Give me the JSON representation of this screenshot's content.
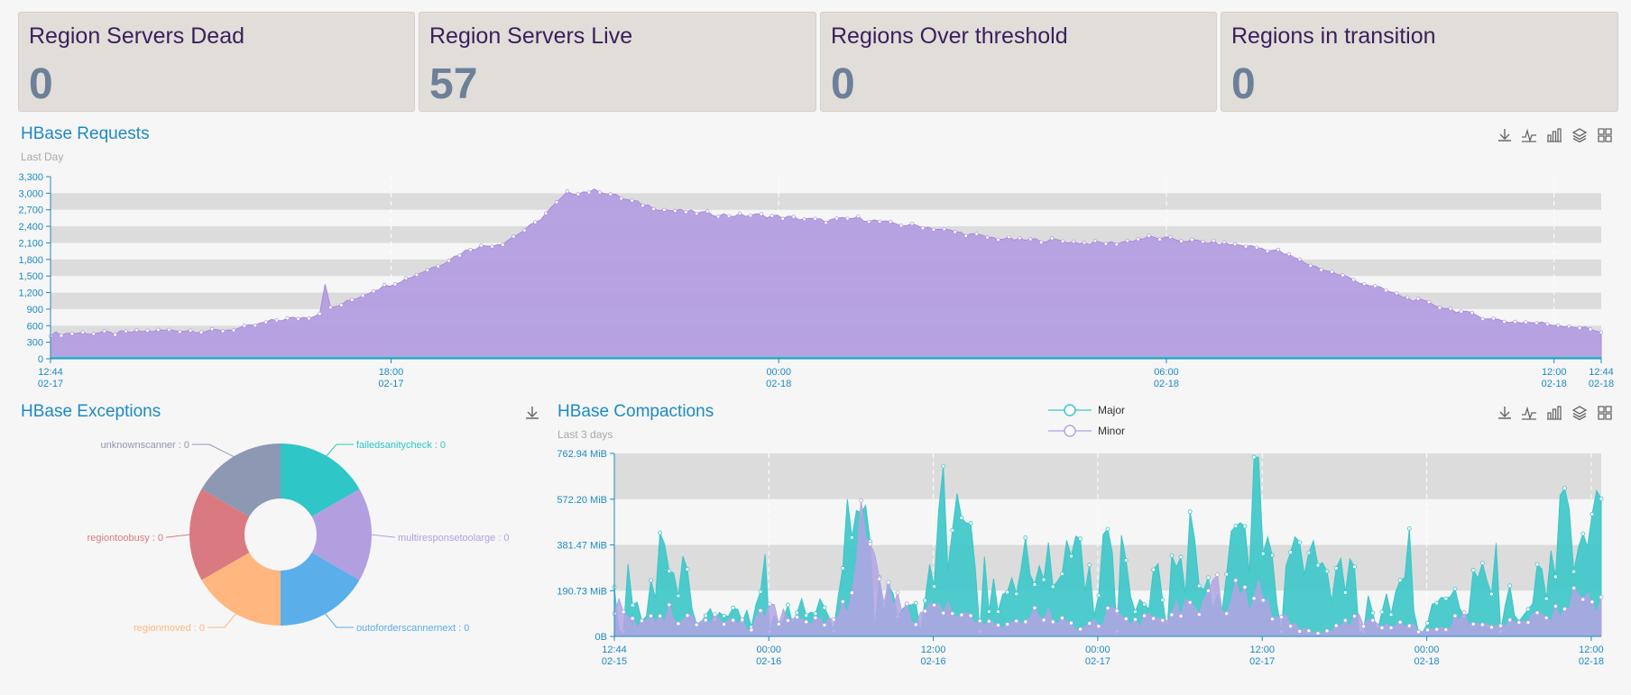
{
  "stats": [
    {
      "title": "Region Servers Dead",
      "value": "0"
    },
    {
      "title": "Region Servers Live",
      "value": "57"
    },
    {
      "title": "Regions Over threshold",
      "value": "0"
    },
    {
      "title": "Regions in transition",
      "value": "0"
    }
  ],
  "requests_panel": {
    "title": "HBase Requests",
    "subtitle": "Last Day"
  },
  "exceptions_panel": {
    "title": "HBase Exceptions"
  },
  "compactions_panel": {
    "title": "HBase Compactions",
    "subtitle": "Last 3 days"
  },
  "toolbar_icons": [
    "download-icon",
    "line-chart-icon",
    "bar-chart-icon",
    "stack-icon",
    "grid-icon"
  ],
  "chart_data": [
    {
      "type": "area",
      "title": "HBase Requests",
      "ylim": [
        0,
        3300
      ],
      "y_ticks": [
        "0",
        "300",
        "600",
        "900",
        "1,200",
        "1,500",
        "1,800",
        "2,100",
        "2,400",
        "2,700",
        "3,000",
        "3,300"
      ],
      "x_ticks": [
        {
          "time": "12:44",
          "date": "02-17"
        },
        {
          "time": "18:00",
          "date": "02-17"
        },
        {
          "time": "00:00",
          "date": "02-18"
        },
        {
          "time": "06:00",
          "date": "02-18"
        },
        {
          "time": "12:00",
          "date": "02-18"
        },
        {
          "time": "12:44",
          "date": "02-18"
        }
      ],
      "x_hours": [
        0,
        5.27,
        11.27,
        17.27,
        23.27,
        24
      ],
      "series": [
        {
          "color": "#b39ddb",
          "x_hours": [
            0,
            0.5,
            1,
            1.5,
            2,
            2.5,
            3,
            3.5,
            4,
            4.5,
            5,
            5.5,
            6,
            6.5,
            7,
            7.5,
            8,
            8.5,
            9,
            9.5,
            10,
            10.5,
            11,
            11.5,
            12,
            12.5,
            13,
            13.5,
            14,
            14.5,
            15,
            15.5,
            16,
            16.5,
            17,
            17.5,
            18,
            18.5,
            19,
            19.5,
            20,
            20.5,
            21,
            21.5,
            22,
            22.5,
            23,
            23.5,
            24
          ],
          "values": [
            450,
            470,
            460,
            500,
            520,
            500,
            560,
            700,
            760,
            980,
            1250,
            1450,
            1700,
            2000,
            2100,
            2450,
            3000,
            3050,
            2850,
            2700,
            2650,
            2600,
            2600,
            2550,
            2500,
            2550,
            2450,
            2400,
            2300,
            2200,
            2150,
            2150,
            2100,
            2100,
            2200,
            2150,
            2100,
            2050,
            1950,
            1700,
            1500,
            1300,
            1100,
            950,
            800,
            680,
            650,
            600,
            500
          ]
        },
        {
          "color": "#22c1c3",
          "values": [
            0
          ]
        }
      ]
    },
    {
      "type": "pie",
      "title": "HBase Exceptions",
      "slices": [
        {
          "label": "failedsanitycheck : 0",
          "value": 1,
          "color": "#2ec6c6"
        },
        {
          "label": "multiresponsetoolarge : 0",
          "value": 1,
          "color": "#b29fe0"
        },
        {
          "label": "outoforderscannernext : 0",
          "value": 1,
          "color": "#5aaeea"
        },
        {
          "label": "regionmoved : 0",
          "value": 1,
          "color": "#ffb77f"
        },
        {
          "label": "regiontoobusy : 0",
          "value": 1,
          "color": "#d97a80"
        },
        {
          "label": "unknownscanner : 0",
          "value": 1,
          "color": "#8d98b3"
        }
      ]
    },
    {
      "type": "area",
      "title": "HBase Compactions",
      "y_ticks": [
        "0B",
        "190.73 MiB",
        "381.47 MiB",
        "572.20 MiB",
        "762.94 MiB"
      ],
      "y_tick_values": [
        0,
        190.73,
        381.47,
        572.2,
        762.94
      ],
      "ylim": [
        0,
        762.94
      ],
      "x_ticks": [
        {
          "time": "12:44",
          "date": "02-15"
        },
        {
          "time": "00:00",
          "date": "02-16"
        },
        {
          "time": "12:00",
          "date": "02-16"
        },
        {
          "time": "00:00",
          "date": "02-17"
        },
        {
          "time": "12:00",
          "date": "02-17"
        },
        {
          "time": "00:00",
          "date": "02-18"
        },
        {
          "time": "12:00",
          "date": "02-18"
        }
      ],
      "x_hours": [
        0,
        11.27,
        23.27,
        35.27,
        47.27,
        59.27,
        71.27
      ],
      "legend": [
        "Major",
        "Minor"
      ],
      "series": [
        {
          "name": "Major",
          "color": "#3cc6c8",
          "x_hours": [
            0,
            2,
            4,
            6,
            8,
            10,
            11,
            12,
            14,
            16,
            17,
            18,
            20,
            22,
            23,
            24,
            26,
            28,
            30,
            32,
            34,
            35,
            36,
            38,
            40,
            42,
            44,
            46,
            47,
            48,
            50,
            52,
            54,
            56,
            58,
            59,
            60,
            62,
            64,
            66,
            68,
            70,
            71,
            72
          ],
          "values": [
            410,
            100,
            500,
            120,
            220,
            80,
            520,
            70,
            240,
            60,
            490,
            540,
            210,
            150,
            340,
            700,
            480,
            160,
            380,
            330,
            600,
            80,
            640,
            110,
            320,
            480,
            200,
            650,
            740,
            340,
            450,
            240,
            320,
            110,
            380,
            30,
            200,
            160,
            380,
            80,
            420,
            640,
            570,
            590
          ]
        },
        {
          "name": "Minor",
          "color": "#b3a4e3",
          "x_hours": [
            0,
            2,
            4,
            6,
            8,
            10,
            11,
            12,
            14,
            16,
            17,
            18,
            20,
            22,
            23,
            24,
            26,
            28,
            30,
            32,
            34,
            35,
            36,
            38,
            40,
            42,
            44,
            46,
            47,
            48,
            50,
            52,
            54,
            56,
            58,
            59,
            60,
            62,
            64,
            66,
            68,
            70,
            71,
            72
          ],
          "values": [
            150,
            60,
            110,
            90,
            80,
            40,
            120,
            100,
            60,
            80,
            140,
            520,
            180,
            70,
            190,
            130,
            70,
            40,
            100,
            90,
            30,
            60,
            110,
            70,
            90,
            140,
            200,
            170,
            190,
            120,
            30,
            20,
            80,
            40,
            60,
            20,
            30,
            90,
            40,
            60,
            100,
            160,
            180,
            170
          ]
        }
      ]
    }
  ]
}
